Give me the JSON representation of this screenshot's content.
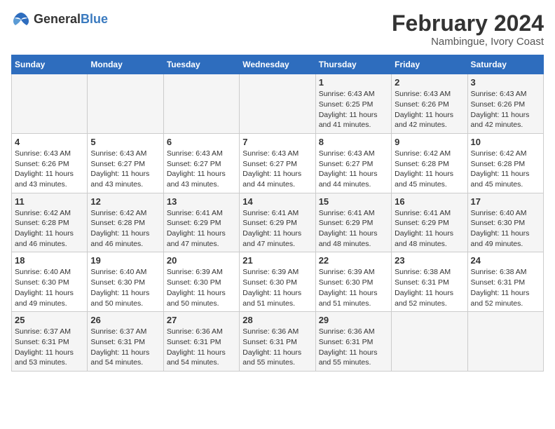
{
  "logo": {
    "general": "General",
    "blue": "Blue"
  },
  "title": "February 2024",
  "subtitle": "Nambingue, Ivory Coast",
  "days_header": [
    "Sunday",
    "Monday",
    "Tuesday",
    "Wednesday",
    "Thursday",
    "Friday",
    "Saturday"
  ],
  "weeks": [
    [
      {
        "day": "",
        "info": ""
      },
      {
        "day": "",
        "info": ""
      },
      {
        "day": "",
        "info": ""
      },
      {
        "day": "",
        "info": ""
      },
      {
        "day": "1",
        "info": "Sunrise: 6:43 AM\nSunset: 6:25 PM\nDaylight: 11 hours\nand 41 minutes."
      },
      {
        "day": "2",
        "info": "Sunrise: 6:43 AM\nSunset: 6:26 PM\nDaylight: 11 hours\nand 42 minutes."
      },
      {
        "day": "3",
        "info": "Sunrise: 6:43 AM\nSunset: 6:26 PM\nDaylight: 11 hours\nand 42 minutes."
      }
    ],
    [
      {
        "day": "4",
        "info": "Sunrise: 6:43 AM\nSunset: 6:26 PM\nDaylight: 11 hours\nand 43 minutes."
      },
      {
        "day": "5",
        "info": "Sunrise: 6:43 AM\nSunset: 6:27 PM\nDaylight: 11 hours\nand 43 minutes."
      },
      {
        "day": "6",
        "info": "Sunrise: 6:43 AM\nSunset: 6:27 PM\nDaylight: 11 hours\nand 43 minutes."
      },
      {
        "day": "7",
        "info": "Sunrise: 6:43 AM\nSunset: 6:27 PM\nDaylight: 11 hours\nand 44 minutes."
      },
      {
        "day": "8",
        "info": "Sunrise: 6:43 AM\nSunset: 6:27 PM\nDaylight: 11 hours\nand 44 minutes."
      },
      {
        "day": "9",
        "info": "Sunrise: 6:42 AM\nSunset: 6:28 PM\nDaylight: 11 hours\nand 45 minutes."
      },
      {
        "day": "10",
        "info": "Sunrise: 6:42 AM\nSunset: 6:28 PM\nDaylight: 11 hours\nand 45 minutes."
      }
    ],
    [
      {
        "day": "11",
        "info": "Sunrise: 6:42 AM\nSunset: 6:28 PM\nDaylight: 11 hours\nand 46 minutes."
      },
      {
        "day": "12",
        "info": "Sunrise: 6:42 AM\nSunset: 6:28 PM\nDaylight: 11 hours\nand 46 minutes."
      },
      {
        "day": "13",
        "info": "Sunrise: 6:41 AM\nSunset: 6:29 PM\nDaylight: 11 hours\nand 47 minutes."
      },
      {
        "day": "14",
        "info": "Sunrise: 6:41 AM\nSunset: 6:29 PM\nDaylight: 11 hours\nand 47 minutes."
      },
      {
        "day": "15",
        "info": "Sunrise: 6:41 AM\nSunset: 6:29 PM\nDaylight: 11 hours\nand 48 minutes."
      },
      {
        "day": "16",
        "info": "Sunrise: 6:41 AM\nSunset: 6:29 PM\nDaylight: 11 hours\nand 48 minutes."
      },
      {
        "day": "17",
        "info": "Sunrise: 6:40 AM\nSunset: 6:30 PM\nDaylight: 11 hours\nand 49 minutes."
      }
    ],
    [
      {
        "day": "18",
        "info": "Sunrise: 6:40 AM\nSunset: 6:30 PM\nDaylight: 11 hours\nand 49 minutes."
      },
      {
        "day": "19",
        "info": "Sunrise: 6:40 AM\nSunset: 6:30 PM\nDaylight: 11 hours\nand 50 minutes."
      },
      {
        "day": "20",
        "info": "Sunrise: 6:39 AM\nSunset: 6:30 PM\nDaylight: 11 hours\nand 50 minutes."
      },
      {
        "day": "21",
        "info": "Sunrise: 6:39 AM\nSunset: 6:30 PM\nDaylight: 11 hours\nand 51 minutes."
      },
      {
        "day": "22",
        "info": "Sunrise: 6:39 AM\nSunset: 6:30 PM\nDaylight: 11 hours\nand 51 minutes."
      },
      {
        "day": "23",
        "info": "Sunrise: 6:38 AM\nSunset: 6:31 PM\nDaylight: 11 hours\nand 52 minutes."
      },
      {
        "day": "24",
        "info": "Sunrise: 6:38 AM\nSunset: 6:31 PM\nDaylight: 11 hours\nand 52 minutes."
      }
    ],
    [
      {
        "day": "25",
        "info": "Sunrise: 6:37 AM\nSunset: 6:31 PM\nDaylight: 11 hours\nand 53 minutes."
      },
      {
        "day": "26",
        "info": "Sunrise: 6:37 AM\nSunset: 6:31 PM\nDaylight: 11 hours\nand 54 minutes."
      },
      {
        "day": "27",
        "info": "Sunrise: 6:36 AM\nSunset: 6:31 PM\nDaylight: 11 hours\nand 54 minutes."
      },
      {
        "day": "28",
        "info": "Sunrise: 6:36 AM\nSunset: 6:31 PM\nDaylight: 11 hours\nand 55 minutes."
      },
      {
        "day": "29",
        "info": "Sunrise: 6:36 AM\nSunset: 6:31 PM\nDaylight: 11 hours\nand 55 minutes."
      },
      {
        "day": "",
        "info": ""
      },
      {
        "day": "",
        "info": ""
      }
    ]
  ]
}
